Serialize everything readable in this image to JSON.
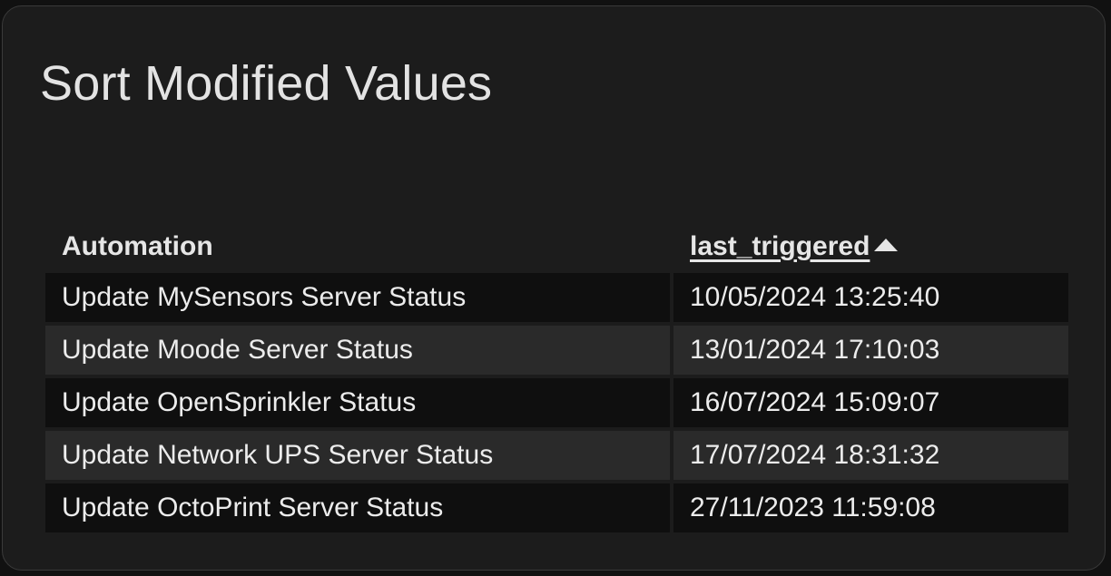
{
  "card": {
    "title": "Sort Modified Values"
  },
  "table": {
    "columns": [
      {
        "label": "Automation",
        "sortable": false
      },
      {
        "label": "last_triggered",
        "sortable": true,
        "sort_direction": "ascending"
      }
    ],
    "rows": [
      {
        "automation": "Update MySensors Server Status",
        "last_triggered": "10/05/2024 13:25:40"
      },
      {
        "automation": "Update Moode Server Status",
        "last_triggered": "13/01/2024 17:10:03"
      },
      {
        "automation": "Update OpenSprinkler Status",
        "last_triggered": "16/07/2024 15:09:07"
      },
      {
        "automation": "Update Network UPS Server Status",
        "last_triggered": "17/07/2024 18:31:32"
      },
      {
        "automation": "Update OctoPrint Server Status",
        "last_triggered": "27/11/2023 11:59:08"
      }
    ]
  },
  "colors": {
    "card_background": "#1c1c1c",
    "row_dark": "#0f0f0f",
    "row_light": "#2a2a2a",
    "text": "#ececec"
  },
  "icons": {
    "sort_indicator": "caret-up-icon"
  }
}
